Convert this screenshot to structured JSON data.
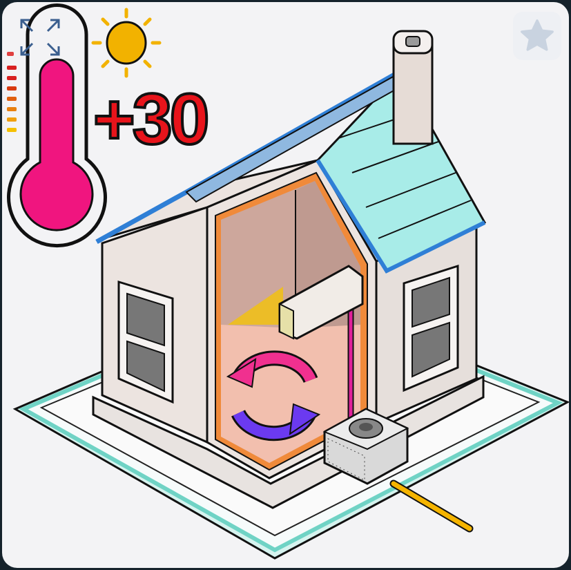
{
  "illustration": {
    "temperature_label": "+30",
    "subject": "house-with-air-conditioner",
    "colors": {
      "thermometer_fill": "#f0157f",
      "temperature_text": "#e8141b",
      "sun": "#f2b200",
      "roof_tiles": "#a8ece8",
      "roof_trim": "#2f7fd6",
      "base_outline": "#6fd3c5"
    }
  },
  "controls": {
    "expand_icon": "expand-arrows-icon",
    "favorite_icon": "star-icon"
  }
}
